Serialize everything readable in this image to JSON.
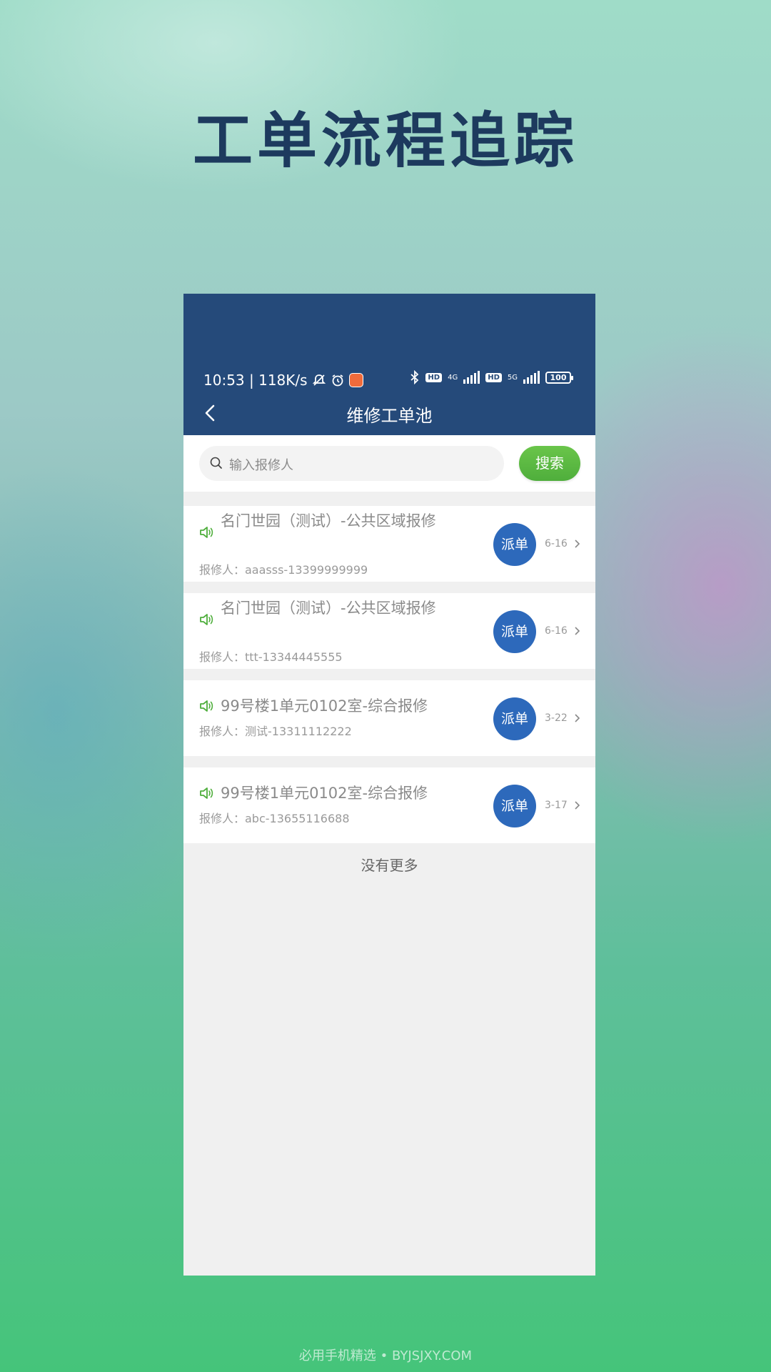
{
  "hero": {
    "title": "工单流程追踪"
  },
  "status_bar": {
    "time_speed": "10:53 | 118K/s",
    "net1": "4G",
    "net2": "5G",
    "hd": "HD",
    "battery": "100"
  },
  "nav": {
    "title": "维修工单池"
  },
  "search": {
    "placeholder": "输入报修人",
    "button_label": "搜索"
  },
  "orders": [
    {
      "title": "名门世园（测试）-公共区域报修",
      "reporter": "报修人：aaasss-13399999999",
      "action": "派单",
      "date": "6-16"
    },
    {
      "title": "名门世园（测试）-公共区域报修",
      "reporter": "报修人：ttt-13344445555",
      "action": "派单",
      "date": "6-16"
    },
    {
      "title": "99号楼1单元0102室-综合报修",
      "reporter": "报修人：测试-13311112222",
      "action": "派单",
      "date": "3-22"
    },
    {
      "title": "99号楼1单元0102室-综合报修",
      "reporter": "报修人：abc-13655116688",
      "action": "派单",
      "date": "3-17"
    }
  ],
  "list_end": "没有更多",
  "footer": "必用手机精选 • BYJSJXY.COM",
  "colors": {
    "header": "#254a7a",
    "accent_green": "#5ab843",
    "dispatch_blue": "#2d69bb"
  },
  "icons": [
    "back-arrow-icon",
    "search-icon",
    "speaker-icon",
    "chevron-right-icon",
    "bluetooth-icon",
    "alarm-icon",
    "mute-bell-icon"
  ]
}
